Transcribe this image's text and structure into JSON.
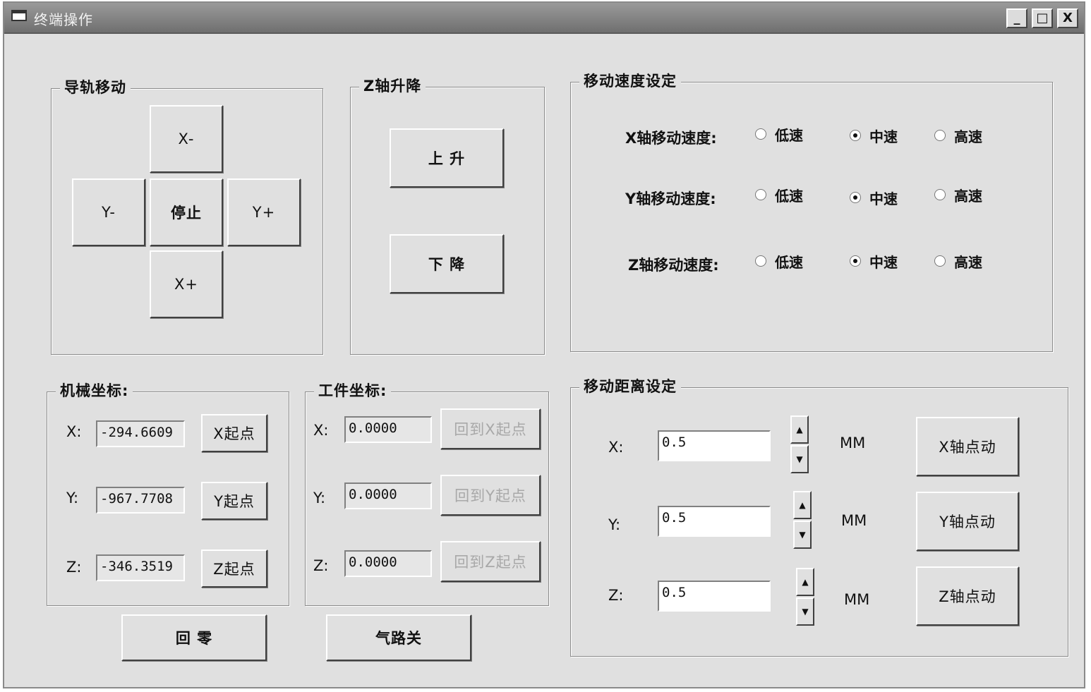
{
  "window": {
    "title": "终端操作",
    "controls": {
      "minimize": "_",
      "maximize": "□",
      "close": "X"
    }
  },
  "rail": {
    "title": "导轨移动",
    "buttons": {
      "x_minus": "X-",
      "y_minus": "Y-",
      "stop": "停止",
      "y_plus": "Y+",
      "x_plus": "X+"
    }
  },
  "z_lift": {
    "title": "Z轴升降",
    "up": "上 升",
    "down": "下 降"
  },
  "speed": {
    "title": "移动速度设定",
    "rows": [
      {
        "label": "X轴移动速度:",
        "options": [
          "低速",
          "中速",
          "高速"
        ],
        "selected": 1
      },
      {
        "label": "Y轴移动速度:",
        "options": [
          "低速",
          "中速",
          "高速"
        ],
        "selected": 1
      },
      {
        "label": "Z轴移动速度:",
        "options": [
          "低速",
          "中速",
          "高速"
        ],
        "selected": 1
      }
    ]
  },
  "mech": {
    "title": "机械坐标:",
    "rows": [
      {
        "label": "X:",
        "value": "-294.6609",
        "button": "X起点"
      },
      {
        "label": "Y:",
        "value": "-967.7708",
        "button": "Y起点"
      },
      {
        "label": "Z:",
        "value": "-346.3519",
        "button": "Z起点"
      }
    ]
  },
  "work": {
    "title": "工件坐标:",
    "rows": [
      {
        "label": "X:",
        "value": "0.0000",
        "button": "回到X起点"
      },
      {
        "label": "Y:",
        "value": "0.0000",
        "button": "回到Y起点"
      },
      {
        "label": "Z:",
        "value": "0.0000",
        "button": "回到Z起点"
      }
    ]
  },
  "distance": {
    "title": "移动距离设定",
    "rows": [
      {
        "label": "X:",
        "value": "0.5",
        "unit": "MM",
        "button": "X轴点动"
      },
      {
        "label": "Y:",
        "value": "0.5",
        "unit": "MM",
        "button": "Y轴点动"
      },
      {
        "label": "Z:",
        "value": "0.5",
        "unit": "MM",
        "button": "Z轴点动"
      }
    ],
    "spin_up": "▲",
    "spin_down": "▼"
  },
  "bottom": {
    "home": "回 零",
    "air": "气路关"
  }
}
